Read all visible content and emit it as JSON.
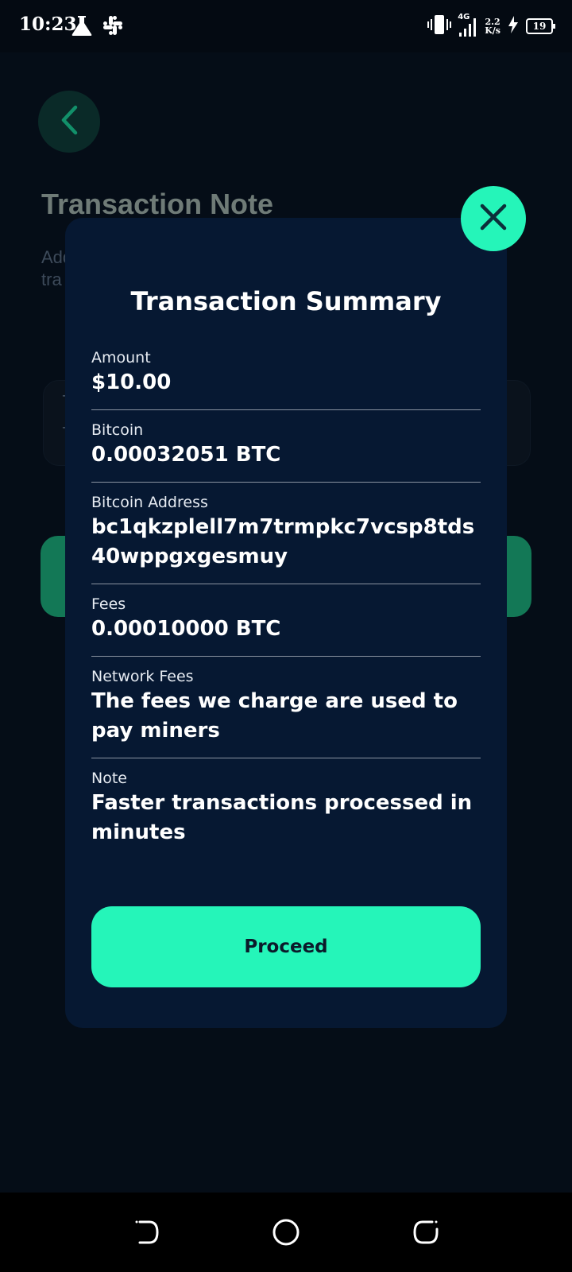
{
  "status_bar": {
    "time": "10:23",
    "network": "4G",
    "speed_value": "2.2",
    "speed_unit": "K/s",
    "battery": "19",
    "left_icons": [
      "flask-icon",
      "slack-icon"
    ],
    "right_icons": [
      "vibrate-icon",
      "signal-icon",
      "charging-icon",
      "battery-icon"
    ]
  },
  "background": {
    "title": "Transaction Note",
    "subtitle_line1": "Add",
    "subtitle_line2": "tra",
    "input_label": "T",
    "input_value": "T"
  },
  "modal": {
    "title": "Transaction Summary",
    "rows": [
      {
        "label": "Amount",
        "value": "$10.00"
      },
      {
        "label": "Bitcoin",
        "value": "0.00032051 BTC"
      },
      {
        "label": "Bitcoin Address",
        "value": "bc1qkzplell7m7trmpkc7vcsp8tds40wppgxgesmuy"
      },
      {
        "label": "Fees",
        "value": "0.00010000 BTC"
      },
      {
        "label": "Network Fees",
        "value": "The fees we charge are used to pay miners"
      },
      {
        "label": "Note",
        "value": "Faster transactions processed in minutes"
      }
    ],
    "proceed_label": "Proceed"
  },
  "colors": {
    "accent": "#25f5b9",
    "modal_bg": "#061832",
    "page_bg": "#040a12"
  }
}
